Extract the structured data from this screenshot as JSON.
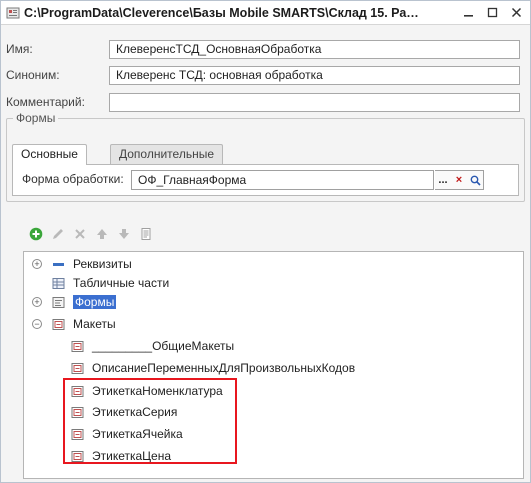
{
  "window": {
    "title": "C:\\ProgramData\\Cleverence\\Базы Mobile SMARTS\\Склад 15. Ра…"
  },
  "fields": {
    "name": {
      "label": "Имя:",
      "value": "КлеверенсТСД_ОсновнаяОбработка"
    },
    "synonym": {
      "label": "Синоним:",
      "value": "Клеверенс ТСД: основная обработка"
    },
    "comment": {
      "label": "Комментарий:",
      "value": ""
    }
  },
  "forms_group": {
    "title": "Формы",
    "tabs": [
      {
        "label": "Основные",
        "active": true
      },
      {
        "label": "Дополнительные",
        "active": false
      }
    ],
    "processing_form": {
      "label": "Форма обработки:",
      "value": "ОФ_ГлавнаяФорма",
      "select_btn": "...",
      "clear_btn": "×"
    }
  },
  "toolbar": {
    "icons": [
      "add-icon",
      "edit-icon",
      "delete-icon",
      "move-up-icon",
      "move-down-icon",
      "properties-icon"
    ]
  },
  "tree": {
    "items": [
      {
        "label": "Реквизиты",
        "expander": "+",
        "icon": "attributes-icon",
        "selected": false
      },
      {
        "label": "Табличные части",
        "expander": "",
        "icon": "table-icon",
        "selected": false
      },
      {
        "label": "Формы",
        "expander": "+",
        "icon": "form-icon",
        "selected": true
      },
      {
        "label": "Макеты",
        "expander": "−",
        "icon": "template-icon",
        "selected": false
      },
      {
        "label": "_________ОбщиеМакеты",
        "expander": "",
        "icon": "template-icon",
        "selected": false
      },
      {
        "label": "ОписаниеПеременныхДляПроизвольныхКодов",
        "expander": "",
        "icon": "template-icon",
        "selected": false
      },
      {
        "label": "ЭтикеткаНоменклатура",
        "expander": "",
        "icon": "template-icon",
        "selected": false
      },
      {
        "label": "ЭтикеткаСерия",
        "expander": "",
        "icon": "template-icon",
        "selected": false
      },
      {
        "label": "ЭтикеткаЯчейка",
        "expander": "",
        "icon": "template-icon",
        "selected": false
      },
      {
        "label": "ЭтикеткаЦена",
        "expander": "",
        "icon": "template-icon",
        "selected": false
      }
    ]
  },
  "colors": {
    "selection": "#3b6fd0",
    "highlight": "#e8171f",
    "add_green": "#3aa63a"
  }
}
